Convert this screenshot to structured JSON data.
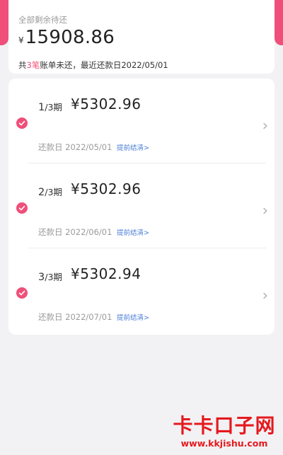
{
  "colors": {
    "accent": "#ef4f79",
    "link": "#4a7fd8",
    "watermark": "#e5191e"
  },
  "summary": {
    "label": "全部剩余待还",
    "currency": "¥",
    "amount": "15908.86",
    "note_prefix": "共",
    "note_count": "3笔",
    "note_suffix": "账单未还，最近还款日2022/05/01"
  },
  "bills": [
    {
      "period_current": "1",
      "period_total": "/3期",
      "amount": "¥5302.96",
      "due": "还款日 2022/05/01",
      "prepay_label": "提前结清>",
      "checked": true
    },
    {
      "period_current": "2",
      "period_total": "/3期",
      "amount": "¥5302.96",
      "due": "还款日 2022/06/01",
      "prepay_label": "提前结清>",
      "checked": true
    },
    {
      "period_current": "3",
      "period_total": "/3期",
      "amount": "¥5302.94",
      "due": "还款日 2022/07/01",
      "prepay_label": "提前结清>",
      "checked": true
    }
  ],
  "icons": {
    "check": "checkmark-icon",
    "chevron": "chevron-right-icon"
  },
  "watermark": {
    "name": "卡卡口子网",
    "url": "www.kkjishu.com"
  }
}
